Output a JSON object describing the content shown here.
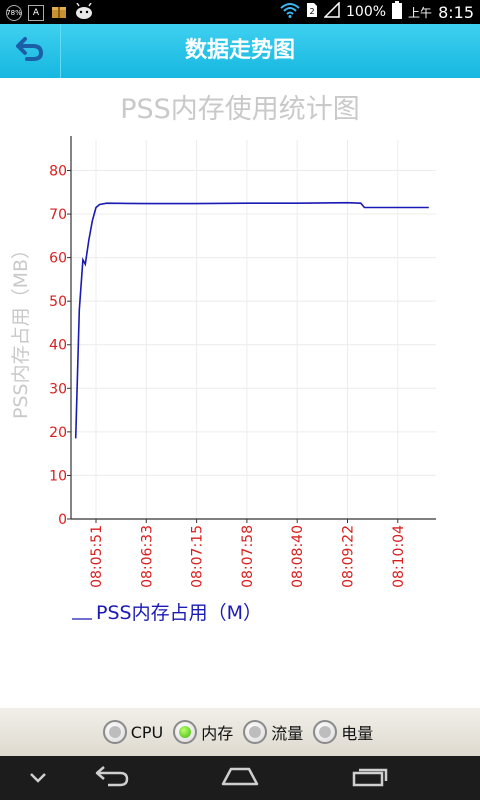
{
  "status_bar": {
    "left_icons": [
      "78%",
      "A"
    ],
    "battery_text": "100%",
    "ampm": "上午",
    "time": "8:15"
  },
  "title_bar": {
    "title": "数据走势图",
    "back_icon": "back-arrow-icon"
  },
  "chart_data": {
    "type": "line",
    "title": "PSS内存使用统计图",
    "ylabel": "PSS内存占用（MB）",
    "xlabel": "",
    "ylim": [
      0,
      87
    ],
    "y_ticks": [
      0,
      10,
      20,
      30,
      40,
      50,
      60,
      70,
      80
    ],
    "x_tick_labels": [
      "08:05:51",
      "08:06:33",
      "08:07:15",
      "08:07:58",
      "08:08:40",
      "08:09:22",
      "08:10:04"
    ],
    "grid": true,
    "legend_position": "bottom-left",
    "colors": {
      "line": "#1a1ab4",
      "tick_label": "#d81e1e",
      "title": "#c9c9c9",
      "grid": "#ececec"
    },
    "series": [
      {
        "name": "PSS内存占用（M）",
        "points": [
          [
            "08:05:34",
            18.5
          ],
          [
            "08:05:37",
            48
          ],
          [
            "08:05:40",
            59.5
          ],
          [
            "08:05:42",
            58.5
          ],
          [
            "08:05:45",
            64
          ],
          [
            "08:05:48",
            68.5
          ],
          [
            "08:05:51",
            71.5
          ],
          [
            "08:05:54",
            72.2
          ],
          [
            "08:06:00",
            72.5
          ],
          [
            "08:06:33",
            72.4
          ],
          [
            "08:07:15",
            72.4
          ],
          [
            "08:07:58",
            72.5
          ],
          [
            "08:08:40",
            72.5
          ],
          [
            "08:09:22",
            72.6
          ],
          [
            "08:09:33",
            72.5
          ],
          [
            "08:09:36",
            71.5
          ],
          [
            "08:10:04",
            71.5
          ],
          [
            "08:10:30",
            71.5
          ]
        ]
      }
    ]
  },
  "radio_group": {
    "options": [
      {
        "label": "CPU",
        "selected": false
      },
      {
        "label": "内存",
        "selected": true
      },
      {
        "label": "流量",
        "selected": false
      },
      {
        "label": "电量",
        "selected": false
      }
    ]
  },
  "nav_bar": {
    "buttons": [
      "chevron-down-icon",
      "back-icon",
      "home-icon",
      "recent-apps-icon"
    ]
  }
}
